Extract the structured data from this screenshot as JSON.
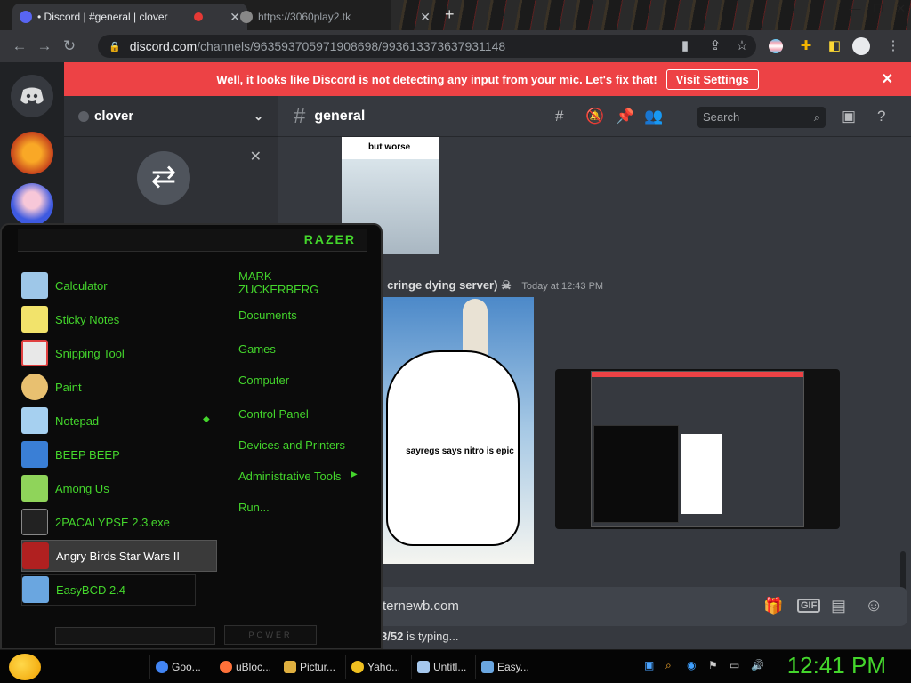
{
  "browser": {
    "tabs": [
      {
        "title": "• Discord | #general | clover",
        "active": true
      },
      {
        "title": "https://3060play2.tk",
        "active": false
      }
    ],
    "address": {
      "host": "discord.com",
      "path": "/channels/963593705971908698/993613373637931148"
    }
  },
  "discord": {
    "banner": {
      "text": "Well, it looks like Discord is not detecting any input from your mic. Let's fix that!",
      "button": "Visit Settings"
    },
    "server_name": "clover",
    "channel_name": "general",
    "search_placeholder": "Search",
    "message": {
      "author_fragment": "ol cringe dying server)",
      "timestamp": "Today at 12:43 PM",
      "meme_caption": "sayregs says nitro is epic",
      "top_caption": "but worse"
    },
    "input_text": "ternewb.com",
    "typing": {
      "who": "3/52",
      "suffix": "is typing..."
    }
  },
  "start_menu": {
    "brand": "RAZER",
    "programs": [
      {
        "label": "Calculator",
        "color": "#9ec7e8"
      },
      {
        "label": "Sticky Notes",
        "color": "#f2e36b"
      },
      {
        "label": "Snipping Tool",
        "color": "#e04040"
      },
      {
        "label": "Paint",
        "color": "#e8c070"
      },
      {
        "label": "Notepad",
        "color": "#a6d0f0"
      },
      {
        "label": "BEEP BEEP",
        "color": "#3a7fd6"
      },
      {
        "label": "Among Us",
        "color": "#8fd45a"
      },
      {
        "label": "2PACALYPSE 2.3.exe",
        "color": "#222222"
      },
      {
        "label": "Angry Birds Star Wars II",
        "color": "#b02020"
      },
      {
        "label": "EasyBCD 2.4",
        "color": "#6aa6e0"
      }
    ],
    "places": [
      "MARK ZUCKERBERG",
      "Documents",
      "Games",
      "Computer",
      "Control Panel",
      "Devices and Printers",
      "Administrative Tools",
      "Run..."
    ],
    "power_label": "POWER"
  },
  "taskbar": {
    "items": [
      {
        "label": "Goo...",
        "color": "#4285f4"
      },
      {
        "label": "uBloc...",
        "color": "#ff7139"
      },
      {
        "label": "Pictur...",
        "color": "#e0b040"
      },
      {
        "label": "Yaho...",
        "color": "#f0c020"
      },
      {
        "label": "Untitl...",
        "color": "#a6c8ee"
      },
      {
        "label": "Easy...",
        "color": "#6aa6e0"
      }
    ],
    "clock": "12:41 PM"
  }
}
